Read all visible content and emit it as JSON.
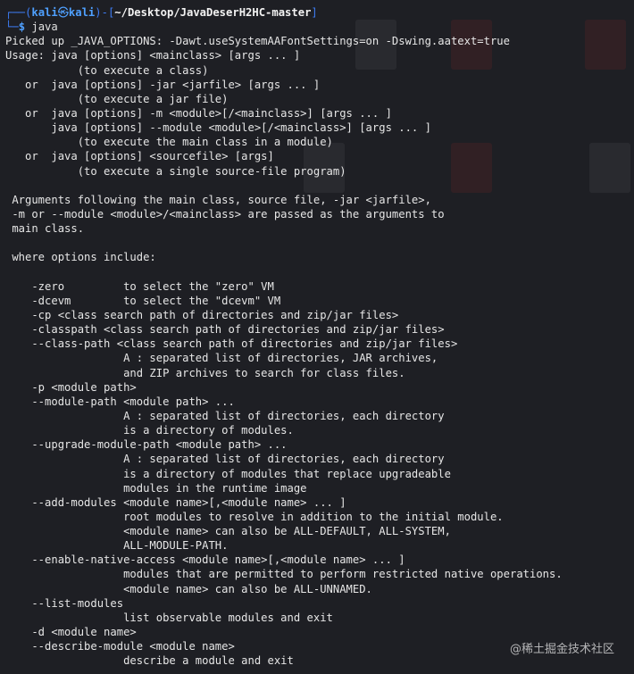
{
  "prompt": {
    "open": "┌──(",
    "user": "kali",
    "at": "㉿",
    "host": "kali",
    "sep": ")-[",
    "path": "~/Desktop/JavaDeserH2HC-master",
    "close": "]",
    "line2": "└─",
    "dollar": "$",
    "command": " java"
  },
  "output": [
    "Picked up _JAVA_OPTIONS: -Dawt.useSystemAAFontSettings=on -Dswing.aatext=true",
    "Usage: java [options] <mainclass> [args ... ]",
    "           (to execute a class)",
    "   or  java [options] -jar <jarfile> [args ... ]",
    "           (to execute a jar file)",
    "   or  java [options] -m <module>[/<mainclass>] [args ... ]",
    "       java [options] --module <module>[/<mainclass>] [args ... ]",
    "           (to execute the main class in a module)",
    "   or  java [options] <sourcefile> [args]",
    "           (to execute a single source-file program)",
    "",
    " Arguments following the main class, source file, -jar <jarfile>,",
    " -m or --module <module>/<mainclass> are passed as the arguments to",
    " main class.",
    "",
    " where options include:",
    "",
    "    -zero         to select the \"zero\" VM",
    "    -dcevm        to select the \"dcevm\" VM",
    "    -cp <class search path of directories and zip/jar files>",
    "    -classpath <class search path of directories and zip/jar files>",
    "    --class-path <class search path of directories and zip/jar files>",
    "                  A : separated list of directories, JAR archives,",
    "                  and ZIP archives to search for class files.",
    "    -p <module path>",
    "    --module-path <module path> ...",
    "                  A : separated list of directories, each directory",
    "                  is a directory of modules.",
    "    --upgrade-module-path <module path> ...",
    "                  A : separated list of directories, each directory",
    "                  is a directory of modules that replace upgradeable",
    "                  modules in the runtime image",
    "    --add-modules <module name>[,<module name> ... ]",
    "                  root modules to resolve in addition to the initial module.",
    "                  <module name> can also be ALL-DEFAULT, ALL-SYSTEM,",
    "                  ALL-MODULE-PATH.",
    "    --enable-native-access <module name>[,<module name> ... ]",
    "                  modules that are permitted to perform restricted native operations.",
    "                  <module name> can also be ALL-UNNAMED.",
    "    --list-modules",
    "                  list observable modules and exit",
    "    -d <module name>",
    "    --describe-module <module name>",
    "                  describe a module and exit"
  ],
  "watermark": "@稀土掘金技术社区",
  "colors": {
    "background": "#1e1f24",
    "prompt_frame": "#3d7cf4",
    "prompt_user": "#4fa0ff",
    "text": "#e6e6e6"
  }
}
